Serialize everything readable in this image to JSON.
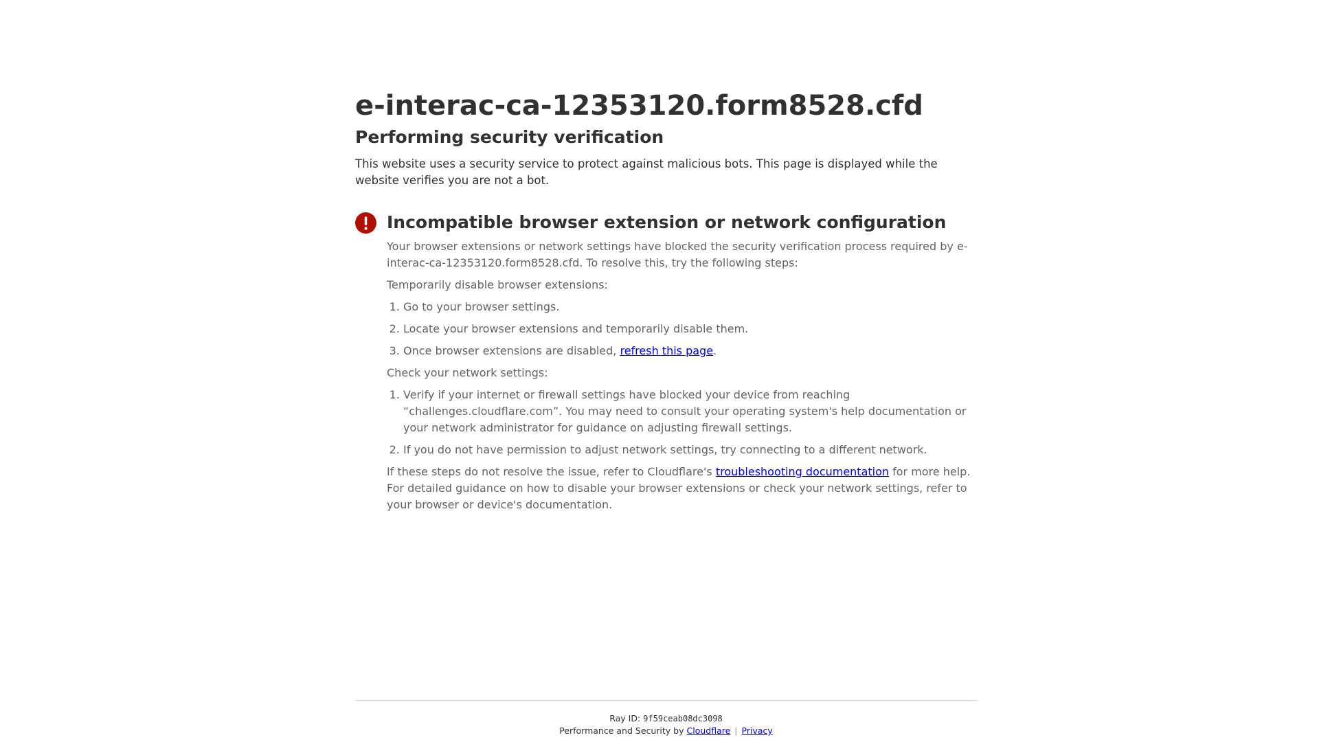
{
  "page": {
    "site_title": "e-interac-ca-12353120.form8528.cfd",
    "subtitle": "Performing security verification",
    "intro": "This website uses a security service to protect against malicious bots. This page is displayed while the website verifies you are not a bot."
  },
  "error": {
    "icon": "exclamation-circle-icon",
    "icon_color": "#b20f03",
    "title": "Incompatible browser extension or network configuration",
    "description": "Your browser extensions or network settings have blocked the security verification process required by e-interac-ca-12353120.form8528.cfd. To resolve this, try the following steps:",
    "extensions_heading": "Temporarily disable browser extensions:",
    "extension_steps": {
      "step1": "Go to your browser settings.",
      "step2": "Locate your browser extensions and temporarily disable them.",
      "step3_prefix": "Once browser extensions are disabled, ",
      "step3_link": "refresh this page",
      "step3_suffix": "."
    },
    "network_heading": "Check your network settings:",
    "network_steps": {
      "step1": "Verify if your internet or firewall settings have blocked your device from reaching “challenges.cloudflare.com”. You may need to consult your operating system's help documentation or your network administrator for guidance on adjusting firewall settings.",
      "step2": "If you do not have permission to adjust network settings, try connecting to a different network."
    },
    "help_prefix": "If these steps do not resolve the issue, refer to Cloudflare's ",
    "help_link": "troubleshooting documentation",
    "help_suffix": " for more help. For detailed guidance on how to disable your browser extensions or check your network settings, refer to your browser or device's documentation."
  },
  "footer": {
    "ray_label": "Ray ID: ",
    "ray_id": "9f59ceab08dc3098",
    "perf_label": "Performance and Security by ",
    "cloudflare_link": "Cloudflare",
    "separator": "|",
    "privacy_link": "Privacy"
  }
}
